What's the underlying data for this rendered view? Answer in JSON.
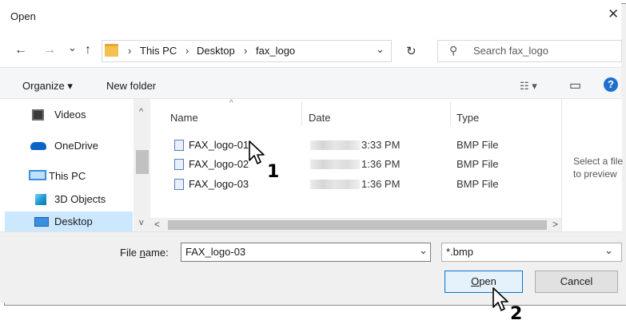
{
  "window": {
    "title": "Open",
    "close_glyph": "✕"
  },
  "nav": {
    "back": "←",
    "forward": "→",
    "recent": "⌄",
    "up": "↑",
    "refresh": "↻",
    "dropdown": "⌄"
  },
  "address": {
    "crumbs": [
      "This PC",
      "Desktop",
      "fax_logo"
    ],
    "separator": "›",
    "lead_sep": "›"
  },
  "search": {
    "placeholder": "Search fax_logo",
    "icon": "⚲"
  },
  "toolbar": {
    "organize": "Organize ▾",
    "new_folder": "New folder",
    "view_glyph": "☷ ▾",
    "pane_glyph": "▭",
    "help_glyph": "?"
  },
  "sidebar": {
    "items": [
      {
        "label": "Videos",
        "icon": "video-folder-icon"
      },
      {
        "label": "OneDrive",
        "icon": "cloud-icon"
      },
      {
        "label": "This PC",
        "icon": "monitor-icon"
      },
      {
        "label": "3D Objects",
        "icon": "cube-icon"
      },
      {
        "label": "Desktop",
        "icon": "desktop-icon",
        "selected": true
      }
    ],
    "scroll_up": "^",
    "scroll_down": "v"
  },
  "columns": {
    "name": "Name",
    "date": "Date",
    "type": "Type",
    "sort_glyph": "^"
  },
  "files": [
    {
      "name": "FAX_logo-01",
      "time": "3:33 PM",
      "type": "BMP File"
    },
    {
      "name": "FAX_logo-02",
      "time": "1:36 PM",
      "type": "BMP File"
    },
    {
      "name": "FAX_logo-03",
      "time": "1:36 PM",
      "type": "BMP File"
    }
  ],
  "preview": {
    "line1": "Select a file",
    "line2": "to preview"
  },
  "hscroll": {
    "left": "<",
    "right": ">"
  },
  "footer": {
    "filename_label_pre": "File ",
    "filename_label_u": "n",
    "filename_label_post": "ame:",
    "filename_value": "FAX_logo-03",
    "filetype_value": "*.bmp",
    "combo_glyph": "⌄",
    "open_pre": "",
    "open_u": "O",
    "open_post": "pen",
    "cancel": "Cancel"
  },
  "callouts": {
    "one": "1",
    "two": "2"
  },
  "colors": {
    "accent": "#0078d7",
    "selection": "#cce8ff",
    "help": "#1e6fd0"
  }
}
